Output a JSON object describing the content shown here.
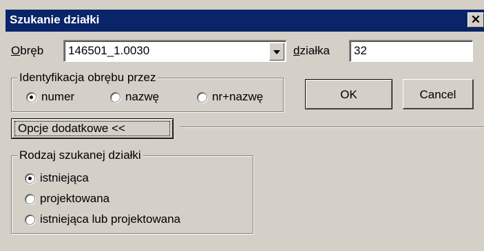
{
  "window": {
    "title": "Szukanie działki",
    "close_glyph": "✕"
  },
  "obreb": {
    "label_underlined": "O",
    "label_rest": "bręb",
    "value": "146501_1.0030"
  },
  "dzialka": {
    "label_underlined": "d",
    "label_rest": "ziałka",
    "value": "32"
  },
  "identification_group": {
    "title": "Identyfikacja obrębu przez",
    "options": [
      {
        "label": "numer",
        "selected": true
      },
      {
        "label": "nazwę",
        "selected": false
      },
      {
        "label": "nr+nazwę",
        "selected": false
      }
    ]
  },
  "buttons": {
    "ok_label": "OK",
    "cancel_label": "Cancel",
    "options_label": "Opcje dodatkowe <<"
  },
  "parcel_type_group": {
    "title": "Rodzaj szukanej działki",
    "options": [
      {
        "label": "istniejąca",
        "selected": true
      },
      {
        "label": "projektowana",
        "selected": false
      },
      {
        "label": "istniejąca lub projektowana",
        "selected": false
      }
    ]
  },
  "icons": {
    "close": "close-icon",
    "dropdown": "chevron-down-icon"
  }
}
